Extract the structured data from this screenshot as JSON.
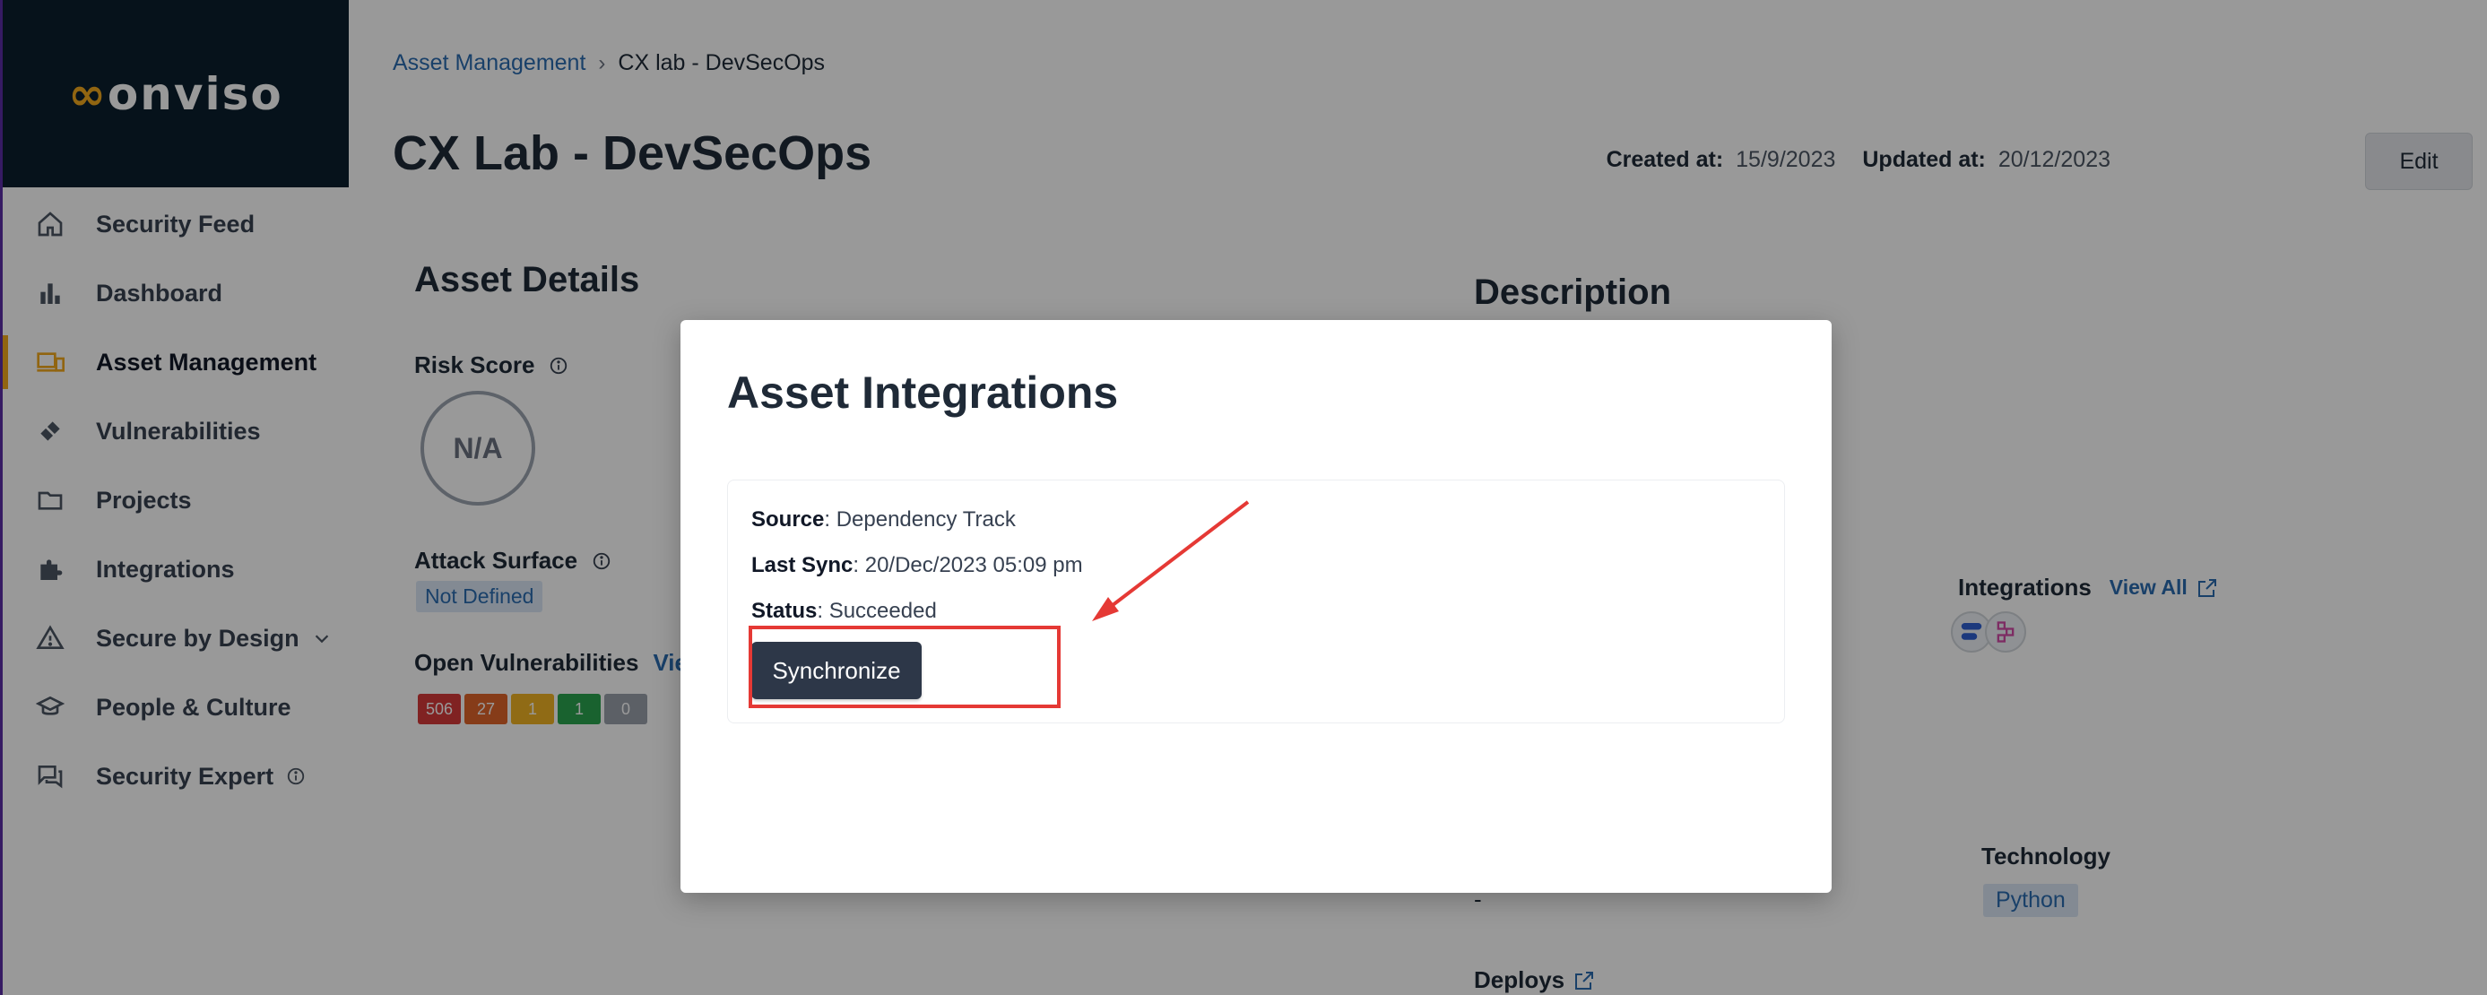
{
  "sidebar": {
    "logo": "conviso",
    "items": [
      {
        "label": "Security Feed",
        "icon": "home-icon"
      },
      {
        "label": "Dashboard",
        "icon": "bar-chart-icon"
      },
      {
        "label": "Asset Management",
        "icon": "devices-icon",
        "active": true
      },
      {
        "label": "Vulnerabilities",
        "icon": "bandage-icon"
      },
      {
        "label": "Projects",
        "icon": "folder-icon"
      },
      {
        "label": "Integrations",
        "icon": "puzzle-icon"
      },
      {
        "label": "Secure by Design",
        "icon": "warning-icon"
      },
      {
        "label": "People & Culture",
        "icon": "graduation-cap-icon"
      },
      {
        "label": "Security Expert",
        "icon": "chat-icon"
      }
    ]
  },
  "breadcrumb": {
    "parent": "Asset Management",
    "current": "CX lab - DevSecOps"
  },
  "page": {
    "title": "CX Lab - DevSecOps",
    "created_label": "Created at:",
    "created_value": "15/9/2023",
    "updated_label": "Updated at:",
    "updated_value": "20/12/2023",
    "edit_label": "Edit"
  },
  "asset_details": {
    "title": "Asset Details",
    "risk_score_label": "Risk Score",
    "risk_score_value": "N/A",
    "attack_surface_label": "Attack Surface",
    "attack_surface_value": "Not Defined",
    "open_vulns_label": "Open Vulnerabilities",
    "view_link": "View",
    "vuln_counts": [
      {
        "value": "506",
        "color": "#d63a3a"
      },
      {
        "value": "27",
        "color": "#e0642b"
      },
      {
        "value": "1",
        "color": "#f0b323"
      },
      {
        "value": "1",
        "color": "#2aa44f"
      },
      {
        "value": "0",
        "color": "#9aa1ab"
      }
    ]
  },
  "description": {
    "title": "Description",
    "integrations_label": "Integrations",
    "view_all_link": "View All",
    "technology_label": "Technology",
    "technology_value": "Python",
    "dash_value": "-",
    "deploys_label": "Deploys"
  },
  "modal": {
    "title": "Asset Integrations",
    "source_label": "Source",
    "source_value": ": Dependency Track",
    "last_sync_label": "Last Sync",
    "last_sync_value": ": 20/Dec/2023 05:09 pm",
    "status_label": "Status",
    "status_value": ": Succeeded",
    "synchronize_label": "Synchronize"
  },
  "colors": {
    "sidebar_bg": "#0b1e2d",
    "accent": "#f2a91d",
    "link": "#2b6cb0",
    "button_dark": "#2d3748",
    "annotation_red": "#e53935"
  }
}
